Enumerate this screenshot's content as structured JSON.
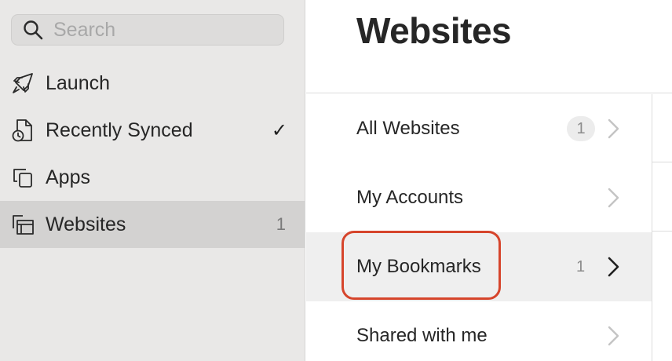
{
  "search": {
    "placeholder": "Search"
  },
  "sidebar": {
    "items": [
      {
        "label": "Launch",
        "icon": "rocket-icon"
      },
      {
        "label": "Recently Synced",
        "icon": "synced-doc-icon",
        "check": "✓"
      },
      {
        "label": "Apps",
        "icon": "apps-icon"
      },
      {
        "label": "Websites",
        "icon": "websites-icon",
        "count": "1",
        "selected": true
      }
    ]
  },
  "header": {
    "title": "Websites"
  },
  "list": {
    "rows": [
      {
        "label": "All Websites",
        "count": "1"
      },
      {
        "label": "My Accounts"
      },
      {
        "label": "My Bookmarks",
        "count": "1",
        "selected": true
      },
      {
        "label": "Shared with me"
      }
    ]
  },
  "colors": {
    "highlight": "#d6452c",
    "sidebar_bg": "#e9e8e7",
    "selected_bg": "#d3d2d1"
  }
}
